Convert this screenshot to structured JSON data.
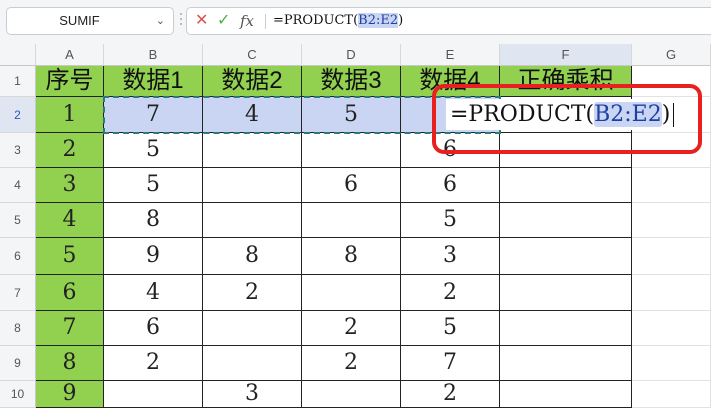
{
  "name_box": {
    "value": "SUMIF"
  },
  "formula_bar": {
    "cancel_icon": "✕",
    "enter_icon": "✓",
    "fx_label": "fx",
    "formula_prefix": "=PRODUCT(",
    "formula_ref": "B2:E2",
    "formula_suffix": ")"
  },
  "columns": [
    "A",
    "B",
    "C",
    "D",
    "E",
    "F",
    "G"
  ],
  "rows": [
    "1",
    "2",
    "3",
    "4",
    "5",
    "6",
    "7",
    "8",
    "9",
    "10"
  ],
  "table": {
    "headers": [
      "序号",
      "数据1",
      "数据2",
      "数据3",
      "数据4",
      "正确乘积"
    ],
    "body": [
      [
        "1",
        "7",
        "4",
        "5",
        "",
        ""
      ],
      [
        "2",
        "5",
        "",
        "",
        "6",
        ""
      ],
      [
        "3",
        "5",
        "",
        "6",
        "6",
        ""
      ],
      [
        "4",
        "8",
        "",
        "",
        "5",
        ""
      ],
      [
        "5",
        "9",
        "8",
        "8",
        "3",
        ""
      ],
      [
        "6",
        "4",
        "2",
        "",
        "2",
        ""
      ],
      [
        "7",
        "6",
        "",
        "2",
        "5",
        ""
      ],
      [
        "8",
        "2",
        "",
        "2",
        "7",
        ""
      ],
      [
        "9",
        "",
        "3",
        "",
        "2",
        ""
      ]
    ]
  },
  "cell_editor": {
    "prefix": "=PRODUCT(",
    "ref": "B2:E2",
    "suffix": ")"
  },
  "colors": {
    "header_fill": "#92d050",
    "selection_fill": "#c9d5f2",
    "callout_border": "#e82020"
  }
}
